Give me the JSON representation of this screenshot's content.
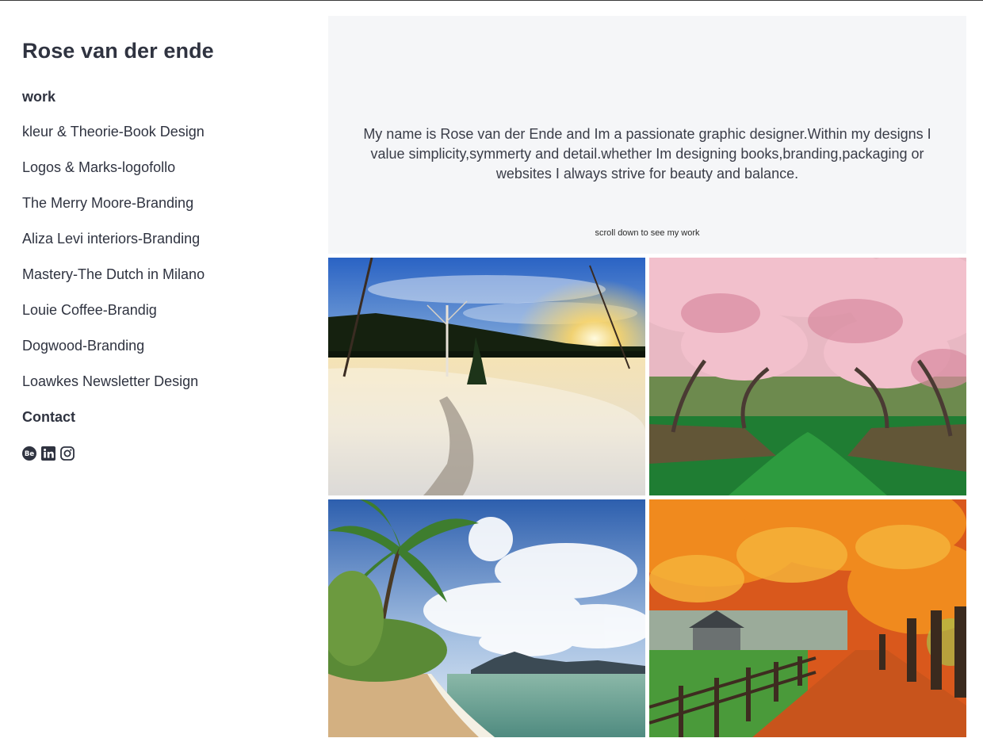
{
  "sidebar": {
    "title": "Rose van der ende",
    "work_heading": "work",
    "nav": [
      "kleur & Theorie-Book Design",
      "Logos & Marks-logofollo",
      "The Merry Moore-Branding",
      "Aliza Levi interiors-Branding",
      "Mastery-The Dutch in Milano",
      "Louie Coffee-Brandig",
      "Dogwood-Branding",
      "Loawkes Newsletter Design"
    ],
    "contact_heading": "Contact",
    "social": [
      "behance-icon",
      "linkedin-icon",
      "instagram-icon"
    ]
  },
  "intro": {
    "text": "My name is Rose van der Ende and Im a passionate graphic designer.Within my designs I value simplicity,symmerty and detail.whether Im designing books,branding,packaging or websites I always strive for beauty and balance.",
    "scroll_note": "scroll down to see my work"
  },
  "gallery": [
    {
      "name": "winter-snow-sunset-image"
    },
    {
      "name": "pink-blossom-trees-image"
    },
    {
      "name": "tropical-beach-palms-image"
    },
    {
      "name": "autumn-orange-trees-image"
    }
  ],
  "colors": {
    "text": "#2f3340",
    "intro_bg": "#f5f6f8",
    "icon": "#2f3340"
  }
}
